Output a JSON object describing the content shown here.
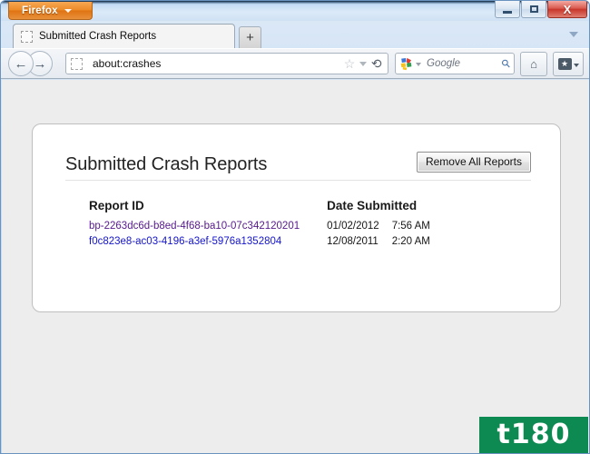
{
  "window": {
    "app_menu_label": "Firefox",
    "controls": {
      "minimize": "minimize-button",
      "maximize": "maximize-button",
      "close_glyph": "X"
    }
  },
  "tabs": {
    "items": [
      {
        "title": "Submitted Crash Reports",
        "favicon": "generic-page-icon"
      }
    ],
    "new_tab_label": "+",
    "list_all_tabs": "list-all-tabs"
  },
  "toolbar": {
    "back_glyph": "←",
    "forward_glyph": "→",
    "url_value": "about:crashes",
    "bookmark_star_glyph": "☆",
    "reload_glyph": "⟳",
    "search_engine": "Google",
    "search_placeholder": "Google",
    "search_go_glyph": "⚲",
    "home_glyph": "⌂",
    "bookmarks_glyph": "★"
  },
  "page": {
    "title": "Submitted Crash Reports",
    "remove_all_label": "Remove All Reports",
    "table": {
      "columns": [
        "Report ID",
        "Date Submitted"
      ],
      "rows": [
        {
          "report_id": "bp-2263dc6d-b8ed-4f68-ba10-07c342120201",
          "date": "01/02/2012",
          "time": "7:56 AM",
          "link_state": "visited"
        },
        {
          "report_id": "f0c823e8-ac03-4196-a3ef-5976a1352804",
          "date": "12/08/2011",
          "time": "2:20 AM",
          "link_state": "unvisited"
        }
      ]
    }
  },
  "watermark": {
    "text": "t180",
    "color": "#0c8a51"
  },
  "colors": {
    "firefox_orange": "#e8871f",
    "visited_link": "#551a8b",
    "unvisited_link": "#1414cd",
    "content_background": "#ededed",
    "close_button_red": "#c8362a"
  }
}
